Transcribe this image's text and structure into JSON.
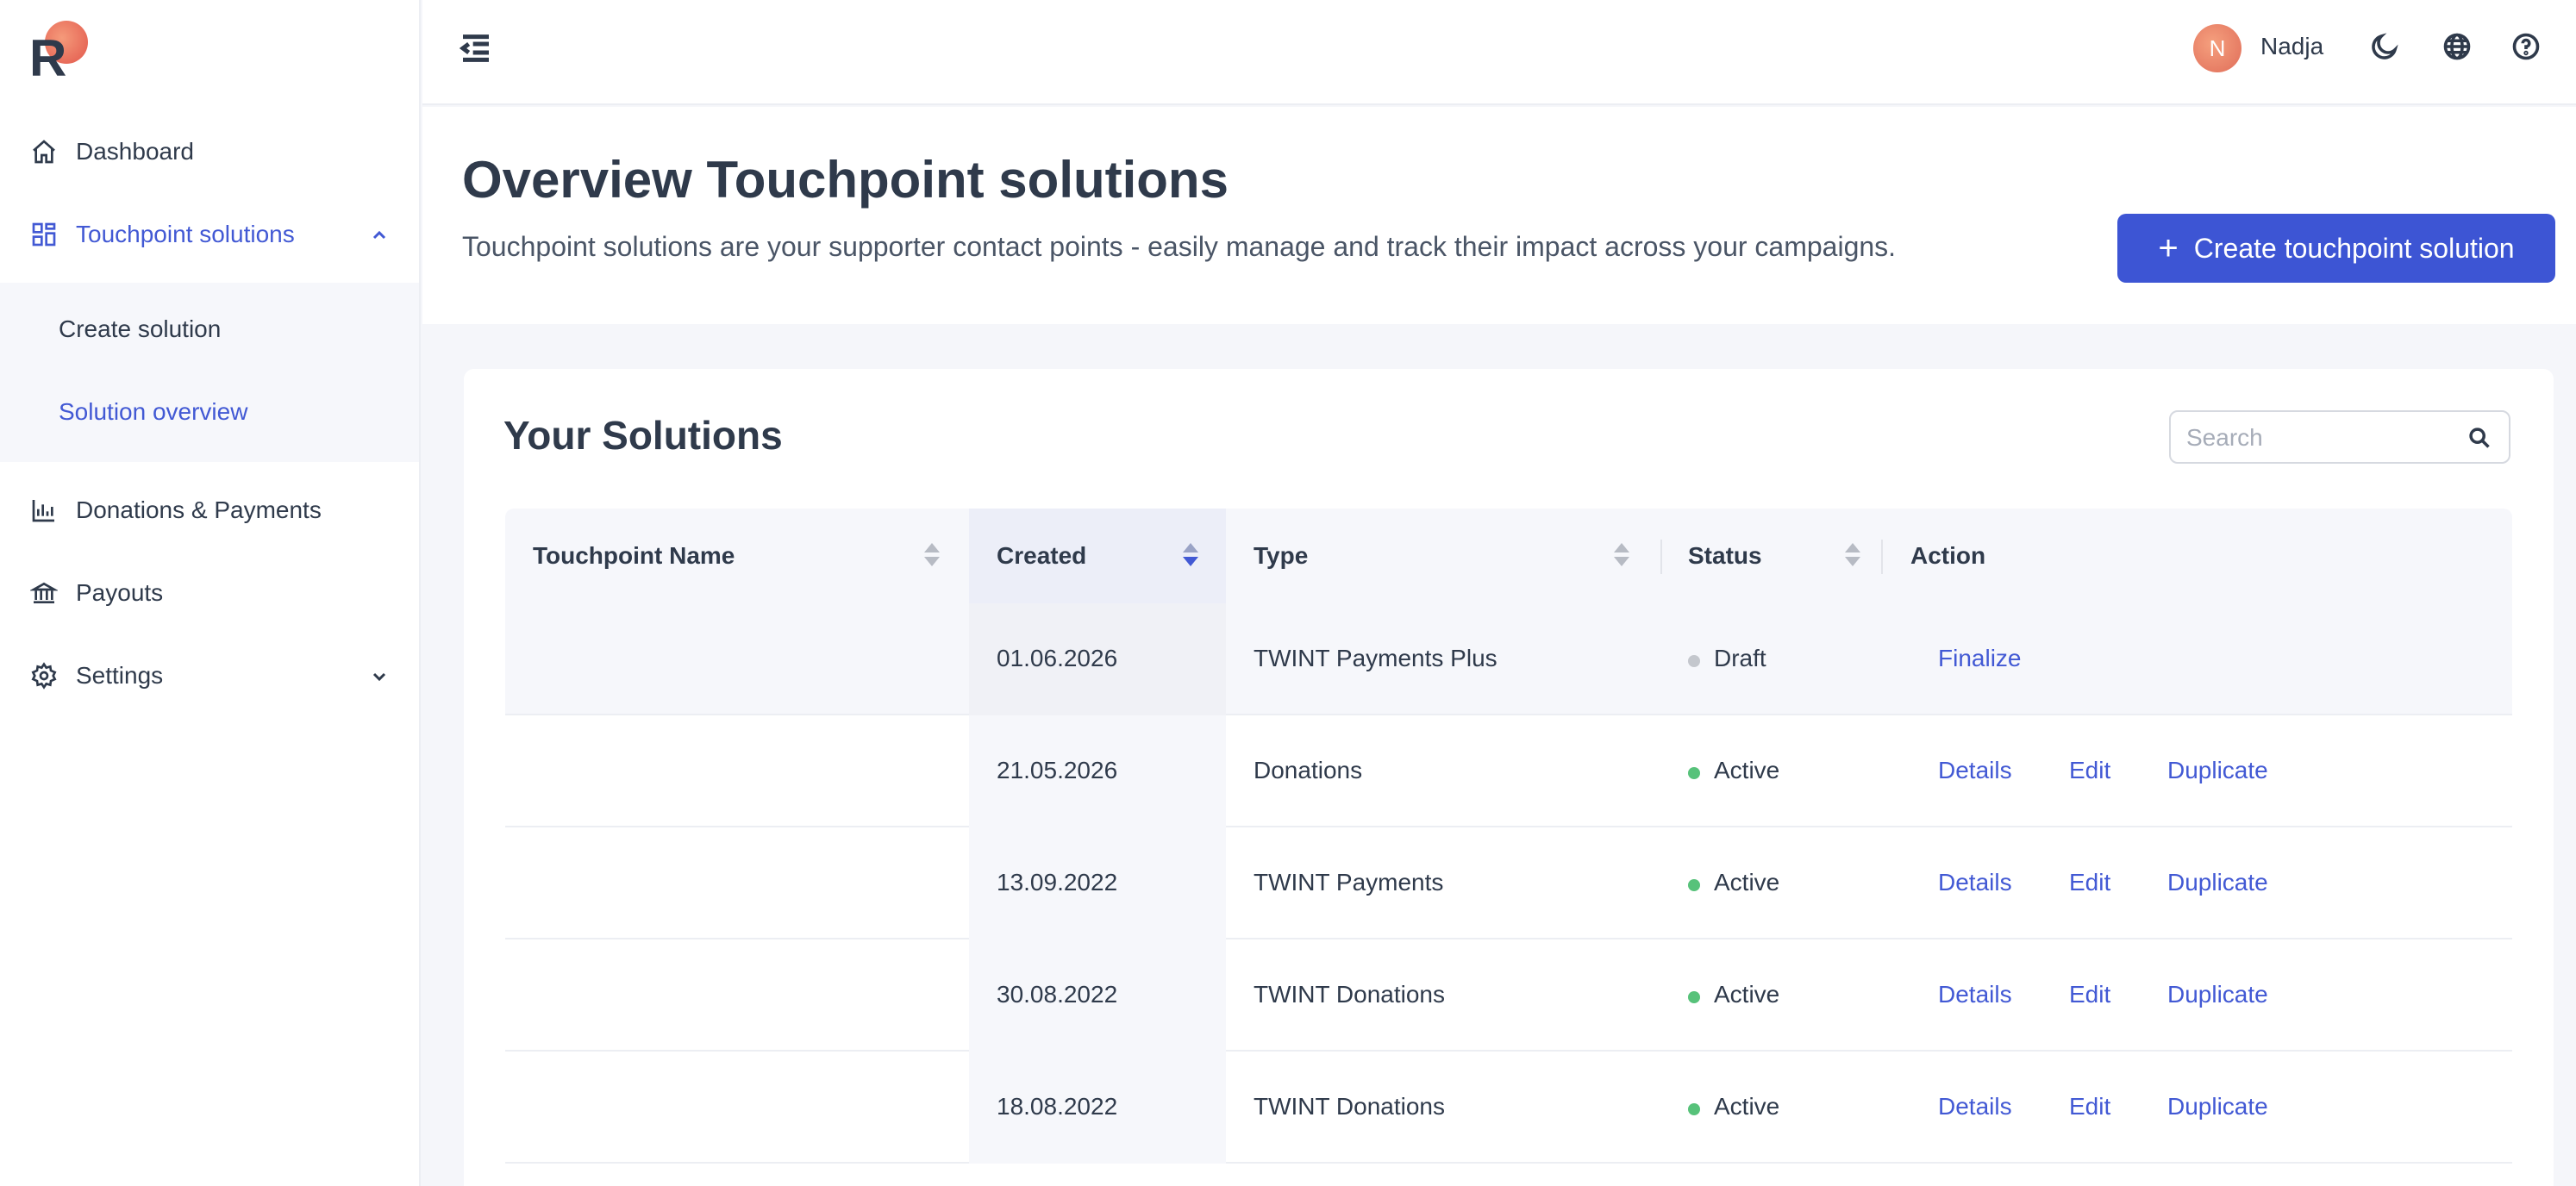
{
  "app": {
    "logo_letter": "R"
  },
  "sidebar": {
    "items": [
      {
        "label": "Dashboard",
        "icon": "home-icon"
      },
      {
        "label": "Touchpoint solutions",
        "icon": "grid-icon",
        "expanded": true
      },
      {
        "label": "Donations & Payments",
        "icon": "chart-icon"
      },
      {
        "label": "Payouts",
        "icon": "bank-icon"
      },
      {
        "label": "Settings",
        "icon": "gear-icon",
        "expanded": false
      }
    ],
    "submenu": [
      {
        "label": "Create solution"
      },
      {
        "label": "Solution overview"
      }
    ]
  },
  "topbar": {
    "avatar_initial": "N",
    "username": "Nadja"
  },
  "header": {
    "title": "Overview Touchpoint solutions",
    "subtitle": "Touchpoint solutions are your supporter contact points - easily manage and track their impact across your campaigns.",
    "create_button": "Create touchpoint solution"
  },
  "solutions": {
    "title": "Your Solutions",
    "search_placeholder": "Search",
    "columns": [
      "Touchpoint Name",
      "Created",
      "Type",
      "Status",
      "Action"
    ],
    "rows": [
      {
        "name": "",
        "created": "01.06.2026",
        "type": "TWINT Payments Plus",
        "status": "Draft",
        "actions": [
          "Finalize"
        ]
      },
      {
        "name": "",
        "created": "21.05.2026",
        "type": "Donations",
        "status": "Active",
        "actions": [
          "Details",
          "Edit",
          "Duplicate"
        ]
      },
      {
        "name": "",
        "created": "13.09.2022",
        "type": "TWINT Payments",
        "status": "Active",
        "actions": [
          "Details",
          "Edit",
          "Duplicate"
        ]
      },
      {
        "name": "",
        "created": "30.08.2022",
        "type": "TWINT Donations",
        "status": "Active",
        "actions": [
          "Details",
          "Edit",
          "Duplicate"
        ]
      },
      {
        "name": "",
        "created": "18.08.2022",
        "type": "TWINT Donations",
        "status": "Active",
        "actions": [
          "Details",
          "Edit",
          "Duplicate"
        ]
      }
    ]
  },
  "colors": {
    "accent": "#3d55d4",
    "active_status": "#57c27a",
    "draft_status": "#c4c7cd"
  }
}
